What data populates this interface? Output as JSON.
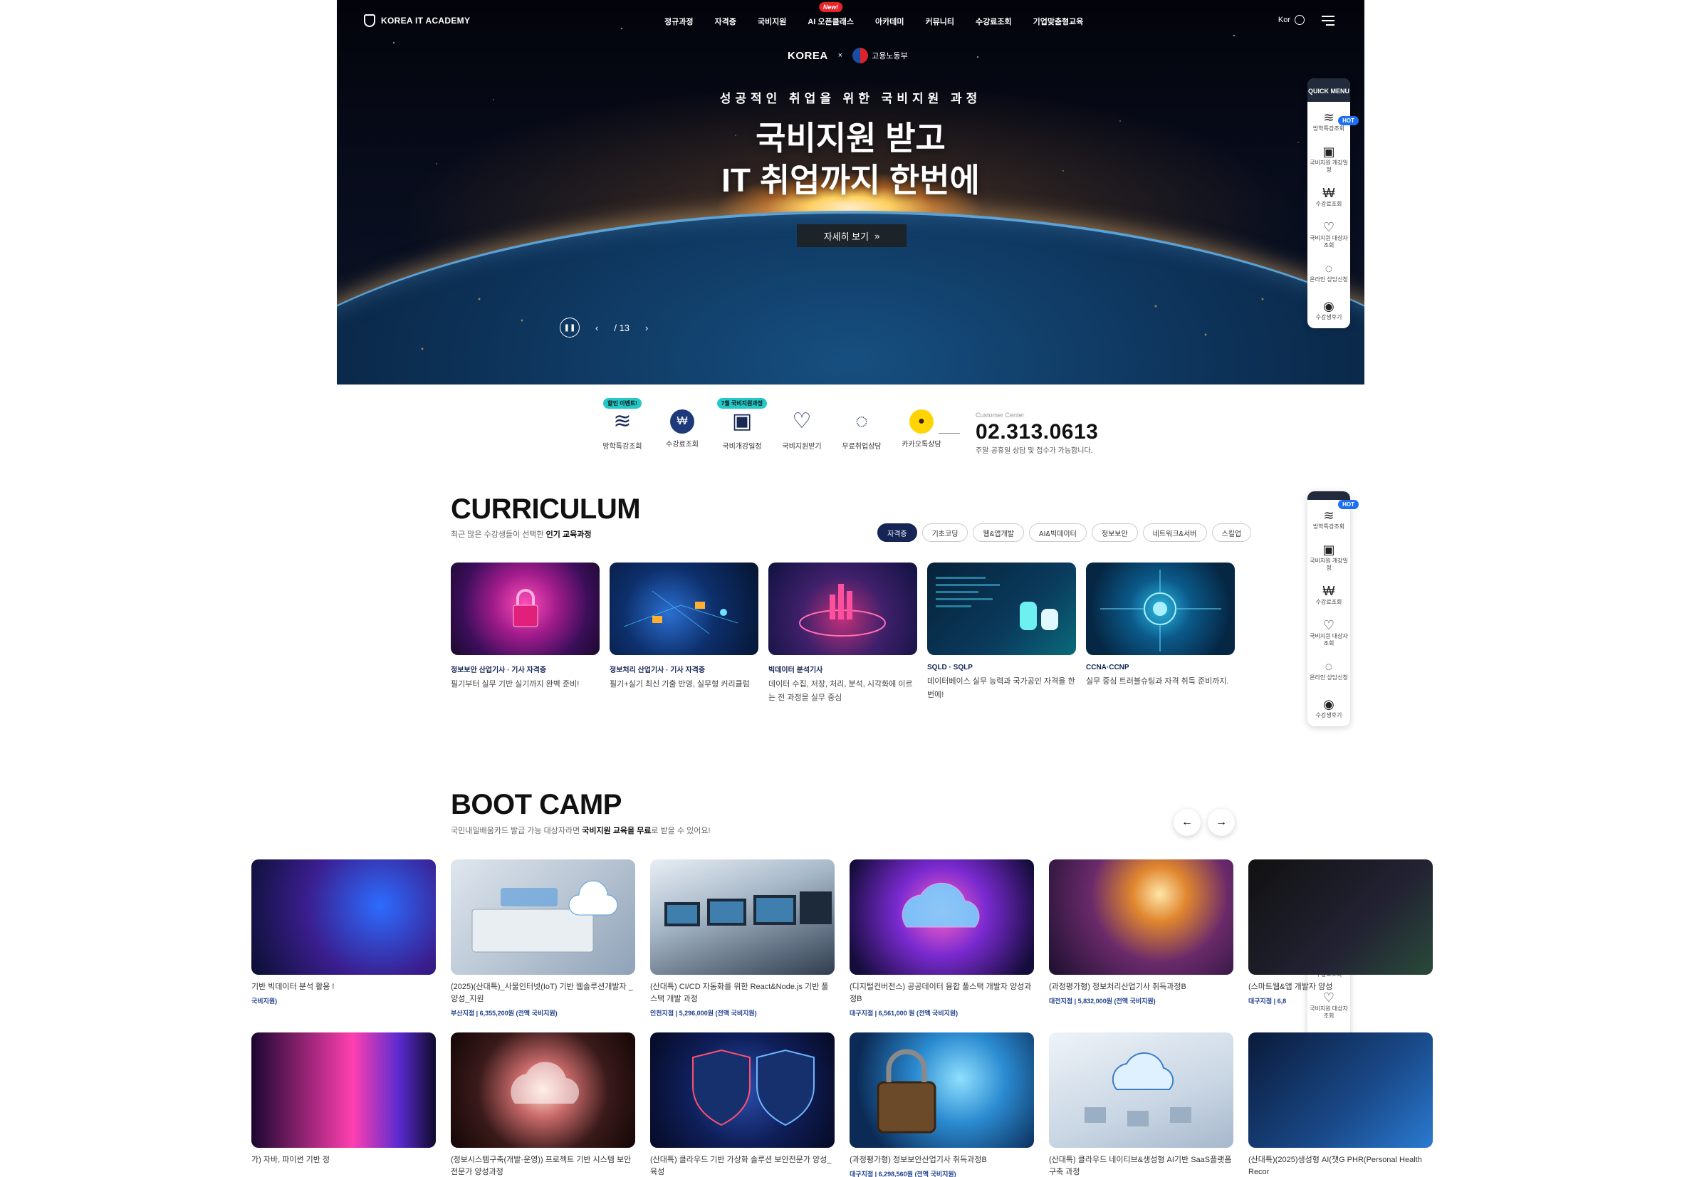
{
  "gnb": {
    "logo": "KOREA IT ACADEMY",
    "menu": [
      {
        "label": "정규과정"
      },
      {
        "label": "자격증"
      },
      {
        "label": "국비지원"
      },
      {
        "label": "AI 오픈클래스",
        "badge": "New!"
      },
      {
        "label": "아카데미"
      },
      {
        "label": "커뮤니티"
      },
      {
        "label": "수강료조회"
      },
      {
        "label": "기업맞춤형교육"
      }
    ],
    "lang": "Kor"
  },
  "hero": {
    "partner_logo": "KOREA",
    "partner_gov": "고용노동부",
    "subtitle": "성공적인 취업을 위한 국비지원 과정",
    "title_line1": "국비지원 받고",
    "title_line2": "IT 취업까지 한번에",
    "button": "자세히 보기",
    "slide_current": "",
    "slide_total": "/ 13"
  },
  "quick_menu": {
    "head": "QUICK MENU",
    "hot": "HOT",
    "items": [
      "방학특강조회",
      "국비지원 개강일정",
      "수강료조회",
      "국비지원 대상자조회",
      "온라인 상담신청",
      "수강생후기"
    ]
  },
  "services": {
    "items": [
      {
        "label": "방학특강조회",
        "badge": "할인 이벤트!",
        "icon": "wave-icon"
      },
      {
        "label": "수강료조회",
        "badge": "",
        "icon": "won-icon"
      },
      {
        "label": "국비개강일정",
        "badge": "7월 국비지원과정",
        "icon": "calendar-icon"
      },
      {
        "label": "국비지원받기",
        "badge": "",
        "icon": "hand-heart-icon"
      },
      {
        "label": "무료취업상담",
        "badge": "",
        "icon": "chat-icon"
      },
      {
        "label": "카카오톡상담",
        "badge": "",
        "icon": "kakao-icon"
      }
    ],
    "customer_label": "Customer Center",
    "phone": "02.313.0613",
    "phone_desc": "주말·공휴일 상담 및 접수가 가능합니다."
  },
  "curriculum": {
    "title": "CURRICULUM",
    "desc_prefix": "최근 많은 수강생들이 선택한 ",
    "desc_bold": "인기 교육과정",
    "tabs": [
      "자격증",
      "기초코딩",
      "웹&앱개발",
      "AI&빅데이터",
      "정보보안",
      "네트워크&서버",
      "스킬업"
    ],
    "cards": [
      {
        "cat": "정보보안 산업기사 · 기사 자격증",
        "text": "필기부터 실무 기반 실기까지 완벽 준비!"
      },
      {
        "cat": "정보처리 산업기사 · 기사 자격증",
        "text": "필기+실기 최신 기출 반영, 실무형 커리큘럼"
      },
      {
        "cat": "빅데이터 분석기사",
        "text": "데이터 수집, 저장, 처리, 분석, 시각화에 이르는 전 과정을 실무 중심"
      },
      {
        "cat": "SQLD · SQLP",
        "text": "데이터베이스 실무 능력과 국가공인 자격을 한 번에!"
      },
      {
        "cat": "CCNA·CCNP",
        "text": "실무 중심 트러블슈팅과 자격 취득 준비까지."
      }
    ]
  },
  "bootcamp": {
    "title": "BOOT CAMP",
    "desc_prefix": "국민내일배움카드 발급 가능 대상자라면 ",
    "desc_bold": "국비지원 교육을 무료",
    "desc_suffix": "로 받을 수 있어요!",
    "row1": [
      {
        "title": "기반 빅데이터 분석 활용 !",
        "price": "국비지원)"
      },
      {
        "title": "(2025)(산대특)_사물인터넷(IoT) 기반 웹솔루션개발자 _양성_지원",
        "branch": "부산지점",
        "price": "6,355,200원 (전액 국비지원)"
      },
      {
        "title": "(산대특) CI/CD 자동화를 위한 React&Node.js 기반 풀스택 개발 과정",
        "branch": "인천지점",
        "price": "5,296,000원 (전액 국비지원)"
      },
      {
        "title": "(디지털컨버전스) 공공데이터 융합 풀스택 개발자 양성과정B",
        "branch": "대구지점",
        "price": "6,561,000 원 (전액 국비지원)"
      },
      {
        "title": "(과정평가형) 정보처리산업기사 취득과정B",
        "branch": "대전지점",
        "price": "5,832,000원 (전액 국비지원)"
      },
      {
        "title": "(스마트웹&앱 개발자 양성",
        "branch": "대구지점",
        "price": "6,8"
      }
    ],
    "row2": [
      {
        "title": "가) 자바, 파이썬 기반 정"
      },
      {
        "title": "(정보시스템구축(개발·운영)) 프로젝트 기반 시스템 보안 전문가 양성과정"
      },
      {
        "title": "(산대특) 클라우드 기반 가상화 솔루션 보안전문가 양성_육성"
      },
      {
        "title": "(과정평가형) 정보보안산업기사 취득과정B",
        "branch": "대구지점",
        "price": "6,298,560원 (전액 국비지원)"
      },
      {
        "title": "(산대특) 클라우드 네이티브&생성형 AI기반 SaaS플랫폼 구축 과정"
      },
      {
        "title": "(산대특)(2025)생성형 AI(챗G PHR(Personal Health Recor"
      }
    ]
  },
  "colors": {
    "navy": "#152656",
    "hot": "#1d6ff2",
    "new": "#e8232a",
    "teal": "#23c8c8"
  }
}
